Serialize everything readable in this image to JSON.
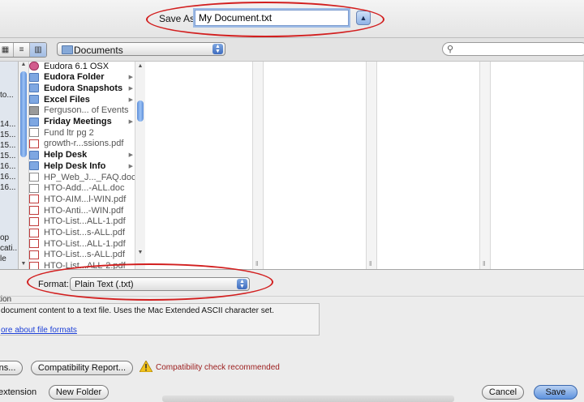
{
  "dialog": {
    "save_as_label": "Save As:",
    "filename": "My Document.txt",
    "expand_glyph": "▲"
  },
  "toolbar": {
    "view_icons": [
      "icon-view-icon",
      "list-view-icon",
      "column-view-icon"
    ],
    "location": "Documents",
    "search_value": ""
  },
  "sidebar": {
    "fragments": [
      "to...",
      "14...",
      "15...",
      "15...",
      "15...",
      "16...",
      "16...",
      "16...",
      "op",
      "cati...",
      "le"
    ]
  },
  "files": [
    {
      "name": "Eudora 6.1 OSX",
      "kind": "app",
      "has_children": false
    },
    {
      "name": "Eudora Folder",
      "kind": "folder",
      "has_children": true
    },
    {
      "name": "Eudora Snapshots",
      "kind": "folder",
      "has_children": true
    },
    {
      "name": "Excel Files",
      "kind": "folder",
      "has_children": true
    },
    {
      "name": "Ferguson... of Events",
      "kind": "gray",
      "has_children": false
    },
    {
      "name": "Friday Meetings",
      "kind": "folder",
      "has_children": true
    },
    {
      "name": "Fund ltr pg 2",
      "kind": "doc",
      "has_children": false
    },
    {
      "name": "growth-r...ssions.pdf",
      "kind": "pdf",
      "has_children": false
    },
    {
      "name": "Help Desk",
      "kind": "folder",
      "has_children": true
    },
    {
      "name": "Help Desk Info",
      "kind": "folder",
      "has_children": true
    },
    {
      "name": "HP_Web_J..._FAQ.doc",
      "kind": "doc",
      "has_children": false
    },
    {
      "name": "HTO-Add...-ALL.doc",
      "kind": "doc",
      "has_children": false
    },
    {
      "name": "HTO-AIM...l-WIN.pdf",
      "kind": "pdf",
      "has_children": false
    },
    {
      "name": "HTO-Anti...-WIN.pdf",
      "kind": "pdf",
      "has_children": false
    },
    {
      "name": "HTO-List...ALL-1.pdf",
      "kind": "pdf",
      "has_children": false
    },
    {
      "name": "HTO-List...s-ALL.pdf",
      "kind": "pdf",
      "has_children": false
    },
    {
      "name": "HTO-List...ALL-1.pdf",
      "kind": "pdf",
      "has_children": false
    },
    {
      "name": "HTO-List...s-ALL.pdf",
      "kind": "pdf",
      "has_children": false
    },
    {
      "name": "HTO-List...ALL-2.pdf",
      "kind": "pdf",
      "has_children": false
    }
  ],
  "format": {
    "label": "Format:",
    "value": "Plain Text (.txt)"
  },
  "description": {
    "heading": "tion",
    "text": "document content to a text file. Uses the Mac Extended ASCII character set.",
    "link": "ore about file formats"
  },
  "buttons": {
    "options_label": "ns...",
    "compat_label": "Compatibility Report...",
    "warning": "Compatibility check recommended",
    "extension_label": "extension",
    "new_folder": "New Folder",
    "cancel": "Cancel",
    "save": "Save"
  },
  "colors": {
    "annotation_red": "#d21f1f",
    "selection_blue": "#5f93de",
    "warning_text": "#9b1c1c"
  }
}
